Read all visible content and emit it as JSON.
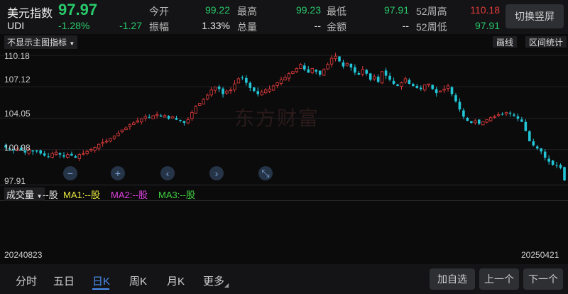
{
  "header": {
    "name": "美元指数",
    "price": "97.97",
    "code": "UDI",
    "pct": "-1.28%",
    "chg": "-1.27",
    "stats": [
      {
        "label": "今开",
        "value": "99.22",
        "color": "g"
      },
      {
        "label": "最高",
        "value": "99.23",
        "color": "g"
      },
      {
        "label": "最低",
        "value": "97.91",
        "color": "g"
      },
      {
        "label": "52周高",
        "value": "110.18",
        "color": "r"
      },
      {
        "label": "振幅",
        "value": "1.33%",
        "color": "w"
      },
      {
        "label": "总量",
        "value": "--",
        "color": "w"
      },
      {
        "label": "金额",
        "value": "--",
        "color": "w"
      },
      {
        "label": "52周低",
        "value": "97.91",
        "color": "g"
      }
    ],
    "view_button": "切换竖屏"
  },
  "toolbar": {
    "indicator": "不显示主图指标",
    "draw": "画线",
    "range": "区间统计"
  },
  "watermark": "东方财富",
  "chart_data": {
    "type": "candlestick",
    "y_ticks": [
      "110.18",
      "107.12",
      "104.05",
      "100.98",
      "97.91"
    ],
    "ylim": [
      97.91,
      110.18
    ],
    "x_start": "20240823",
    "x_end": "20250421",
    "closes": [
      101.2,
      101.0,
      100.9,
      101.1,
      100.9,
      100.7,
      101.0,
      100.8,
      100.8,
      100.6,
      100.4,
      100.3,
      100.6,
      100.7,
      100.5,
      100.3,
      100.5,
      100.4,
      100.2,
      100.5,
      100.6,
      100.8,
      101.0,
      101.2,
      101.5,
      101.7,
      101.8,
      102.1,
      102.3,
      102.6,
      102.9,
      103.1,
      103.4,
      103.6,
      103.8,
      104.0,
      104.2,
      104.1,
      104.3,
      104.4,
      104.2,
      104.3,
      104.0,
      104.2,
      103.9,
      103.8,
      103.6,
      103.9,
      104.6,
      105.2,
      105.5,
      105.9,
      106.3,
      106.8,
      107.1,
      106.9,
      106.4,
      106.7,
      106.8,
      107.4,
      107.9,
      108.0,
      107.5,
      107.0,
      106.7,
      106.4,
      106.6,
      106.8,
      106.9,
      107.2,
      107.5,
      107.8,
      108.0,
      108.4,
      108.6,
      108.9,
      109.3,
      108.8,
      108.5,
      108.9,
      108.6,
      108.3,
      108.8,
      109.3,
      109.9,
      110.1,
      109.6,
      109.1,
      109.4,
      109.0,
      108.5,
      108.3,
      108.8,
      108.4,
      107.8,
      108.1,
      107.6,
      108.6,
      108.2,
      107.8,
      107.4,
      107.2,
      107.5,
      107.9,
      107.4,
      107.2,
      107.0,
      106.9,
      107.3,
      107.4,
      106.9,
      106.5,
      106.7,
      106.9,
      107.2,
      106.4,
      105.7,
      104.9,
      104.2,
      103.8,
      103.6,
      103.8,
      103.5,
      103.7,
      103.9,
      104.1,
      104.2,
      104.4,
      104.4,
      104.6,
      104.5,
      104.3,
      104.0,
      103.7,
      102.8,
      101.8,
      101.4,
      101.1,
      100.8,
      100.2,
      99.8,
      99.5,
      99.4,
      99.2,
      97.98
    ],
    "volume_label": "成交量",
    "volume_unit": "--股",
    "ma": [
      {
        "name": "MA1",
        "text": "MA1:--股",
        "color": "#e6e640"
      },
      {
        "name": "MA2",
        "text": "MA2:--股",
        "color": "#e040e0"
      },
      {
        "name": "MA3",
        "text": "MA3:--股",
        "color": "#40d040"
      }
    ]
  },
  "controls": [
    {
      "icon": "minus-icon",
      "glyph": "−"
    },
    {
      "icon": "plus-icon",
      "glyph": "+"
    },
    {
      "icon": "chevron-left-icon",
      "glyph": "‹"
    },
    {
      "icon": "chevron-right-icon",
      "glyph": "›"
    },
    {
      "icon": "collapse-icon",
      "glyph": "⤡"
    }
  ],
  "tabs": [
    "分时",
    "五日",
    "日K",
    "周K",
    "月K",
    "更多"
  ],
  "active_tab": "日K",
  "buttons": {
    "add": "加自选",
    "prev": "上一个",
    "next": "下一个"
  },
  "colors": {
    "up": "#e23b3b",
    "down": "#22c5d6",
    "accent": "#29c86a"
  }
}
